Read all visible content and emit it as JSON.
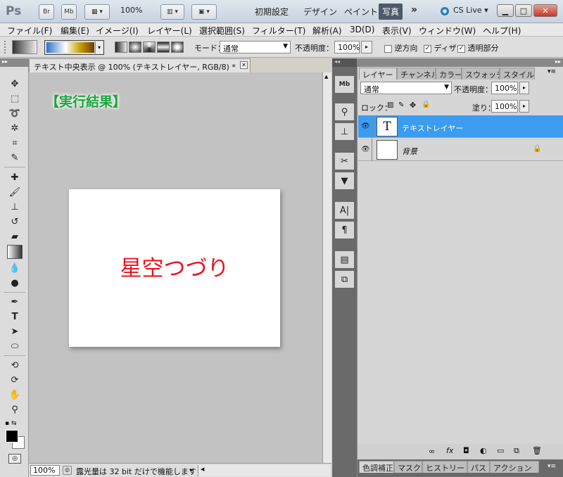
{
  "titlebar": {
    "app_logo": "Ps",
    "br": "Br",
    "mb": "Mb",
    "zoom": "100%",
    "workspaces": [
      "初期設定",
      "デザイン",
      "ペイント",
      "写真"
    ],
    "more": "»",
    "cslive": "CS Live"
  },
  "menu": [
    "ファイル(F)",
    "編集(E)",
    "イメージ(I)",
    "レイヤー(L)",
    "選択範囲(S)",
    "フィルター(T)",
    "解析(A)",
    "3D(D)",
    "表示(V)",
    "ウィンドウ(W)",
    "ヘルプ(H)"
  ],
  "options": {
    "mode_label": "モード：",
    "mode_value": "通常",
    "opacity_label": "不透明度：",
    "opacity_value": "100%",
    "reverse_label": "逆方向",
    "dither_label": "ディザ",
    "transparency_label": "透明部分"
  },
  "document": {
    "tab_title": "テキスト中央表示 @ 100% (テキストレイヤー, RGB/8) *",
    "result_label": "【実行結果】",
    "canvas_text": "星空つづり",
    "zoom": "100%",
    "status_text": "露光量は 32 bit だけで機能します"
  },
  "layers_panel": {
    "tabs": [
      "レイヤー",
      "チャンネル",
      "カラー",
      "スウォッチ",
      "スタイル"
    ],
    "blend_mode": "通常",
    "opacity_label": "不透明度：",
    "opacity_value": "100%",
    "lock_label": "ロック：",
    "fill_label": "塗り：",
    "fill_value": "100%",
    "layers": [
      {
        "name": "テキストレイヤー",
        "thumb": "T",
        "selected": true
      },
      {
        "name": "背景",
        "thumb": "",
        "selected": false
      }
    ]
  },
  "bottom_tabs": [
    "色調補正",
    "マスク",
    "ヒストリー",
    "パス",
    "アクション"
  ],
  "colors": {
    "selection_blue": "#3b9cf0",
    "canvas_text_red": "#e8141e",
    "result_green": "#1aa53a"
  }
}
